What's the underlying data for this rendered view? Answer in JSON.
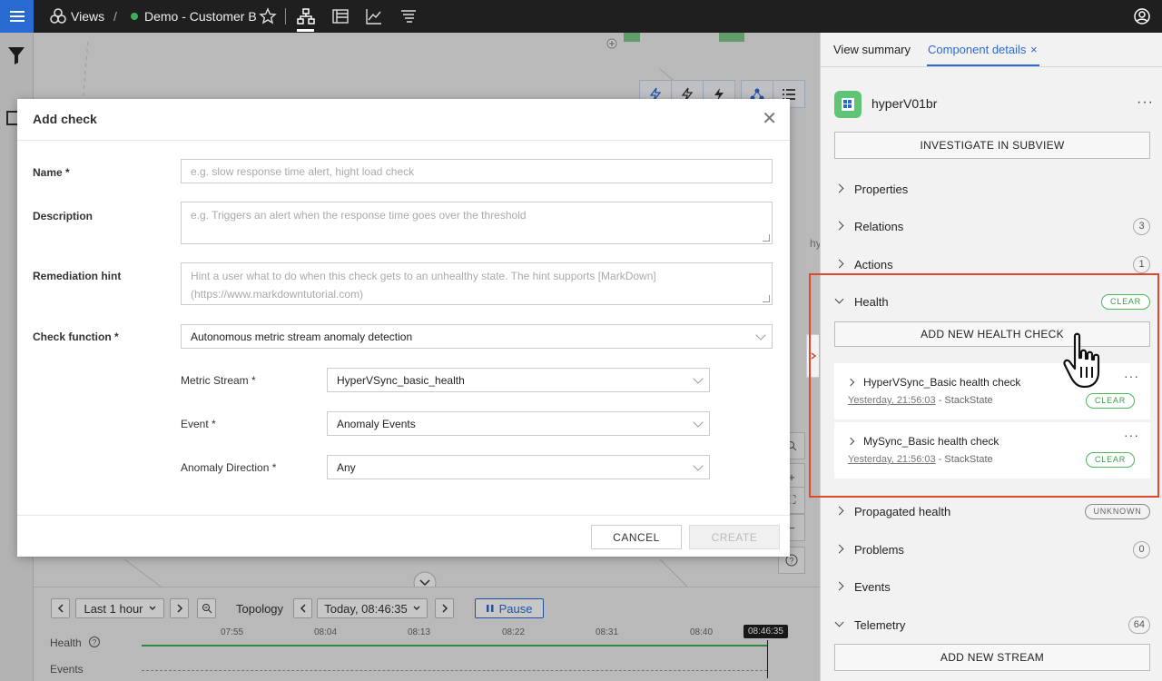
{
  "topbar": {
    "views_label": "Views",
    "separator": "/",
    "view_name": "Demo - Customer B"
  },
  "canvas": {
    "partial_label": "hy"
  },
  "timeline": {
    "range_label": "Last 1 hour",
    "topology_label": "Topology",
    "time_label": "Today, 08:46:35",
    "pause_label": "Pause",
    "ticks": [
      "07:55",
      "08:04",
      "08:13",
      "08:22",
      "08:31",
      "08:40"
    ],
    "current_time": "08:46:35",
    "health_label": "Health",
    "events_label": "Events",
    "colors": {
      "health_line": "#3fae5a",
      "accent": "#2a6bd1"
    }
  },
  "modal": {
    "title": "Add check",
    "name_label": "Name *",
    "name_placeholder": "e.g. slow response time alert, hight load check",
    "description_label": "Description",
    "description_placeholder": "e.g. Triggers an alert when the response time goes over the threshold",
    "remediation_label": "Remediation hint",
    "remediation_placeholder": "Hint a user what to do when this check gets to an unhealthy state. The hint supports [MarkDown](https://www.markdowntutorial.com)",
    "check_function_label": "Check function *",
    "check_function_value": "Autonomous metric stream anomaly detection",
    "metric_stream_label": "Metric Stream *",
    "metric_stream_value": "HyperVSync_basic_health",
    "event_label": "Event *",
    "event_value": "Anomaly Events",
    "anomaly_direction_label": "Anomaly Direction *",
    "anomaly_direction_value": "Any",
    "cancel_label": "CANCEL",
    "create_label": "CREATE"
  },
  "right_panel": {
    "tab_view_summary": "View summary",
    "tab_component_details": "Component details",
    "component_name": "hyperV01br",
    "investigate_label": "INVESTIGATE IN SUBVIEW",
    "sections": {
      "properties": "Properties",
      "relations": "Relations",
      "relations_count": "3",
      "actions": "Actions",
      "actions_count": "1",
      "health": "Health",
      "health_status": "CLEAR",
      "propagated_health": "Propagated health",
      "propagated_status": "UNKNOWN",
      "problems": "Problems",
      "problems_count": "0",
      "events": "Events",
      "telemetry": "Telemetry",
      "telemetry_count": "64"
    },
    "add_health_check_label": "ADD NEW HEALTH CHECK",
    "health_checks": [
      {
        "title": "HyperVSync_Basic health check",
        "time": "Yesterday, 21:56:03",
        "source": "- StackState",
        "status": "CLEAR"
      },
      {
        "title": "MySync_Basic health check",
        "time": "Yesterday, 21:56:03",
        "source": "- StackState",
        "status": "CLEAR"
      }
    ],
    "add_stream_label": "ADD NEW STREAM",
    "colors": {
      "clear": "#3fae5a",
      "highlight": "#e3452f"
    }
  }
}
